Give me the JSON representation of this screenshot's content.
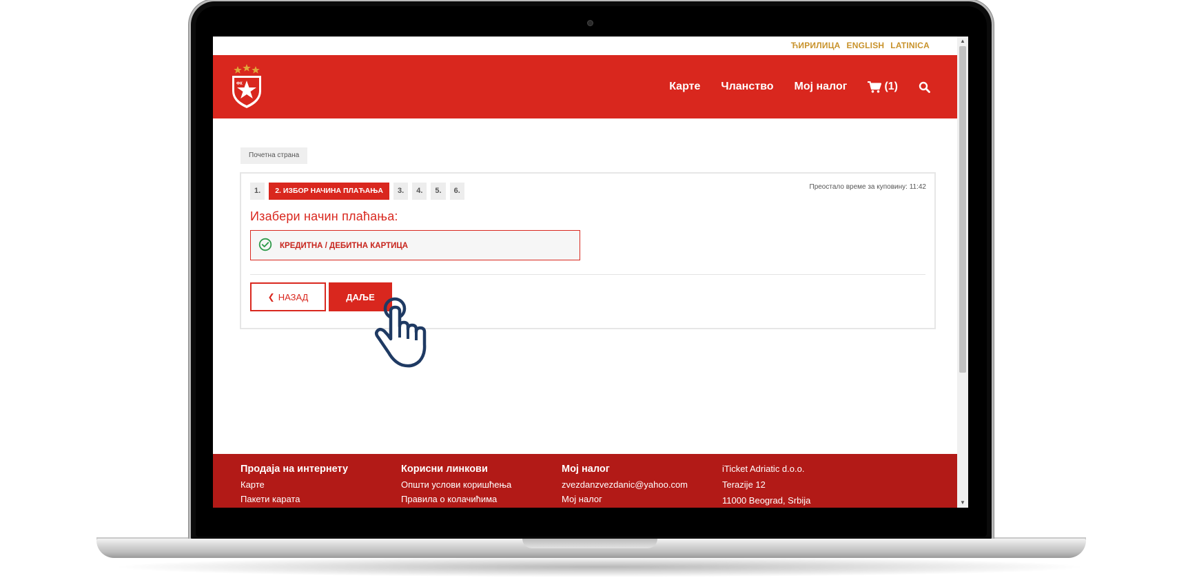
{
  "language_links": [
    "ЋИРИЛИЦА",
    "ENGLISH",
    "LATINICA"
  ],
  "nav": {
    "items": [
      "Карте",
      "Чланство",
      "Мој налог"
    ],
    "cart_label": "(1)"
  },
  "breadcrumb": "Почетна страна",
  "checkout": {
    "steps": [
      "1.",
      "2. ИЗБОР НАЧИНА ПЛАЋАЊА",
      "3.",
      "4.",
      "5.",
      "6."
    ],
    "active_step": 2,
    "timer_text": "Преостало време за куповину: 11:42",
    "heading": "Изабери начин плаћања:",
    "payment_option": "КРЕДИТНА / ДЕБИТНА КАРТИЦА",
    "back_label": "НАЗАД",
    "next_label": "ДАЉЕ"
  },
  "footer": {
    "columns": [
      {
        "title": "Продаја на интернету",
        "items": [
          "Карте",
          "Пакети карата"
        ]
      },
      {
        "title": "Корисни линкови",
        "items": [
          "Општи услови коришћења",
          "Правила о колачићима"
        ]
      },
      {
        "title": "Мој налог",
        "items": [
          "zvezdanzvezdanic@yahoo.com",
          "Мој налог"
        ]
      }
    ],
    "address": [
      "iTicket Adriatic d.o.o.",
      "Terazije 12",
      "11000 Beograd, Srbija"
    ]
  },
  "colors": {
    "brand_red": "#d9271e",
    "footer_red": "#b21a17",
    "gold": "#c8922a",
    "success_green": "#2e9a4a",
    "hand_cursor": "#1f3a63"
  },
  "icons": {
    "logo": "red-star-crest-icon",
    "cart": "cart-icon",
    "search": "search-icon",
    "check": "check-circle-icon",
    "cursor": "hand-pointer-icon"
  }
}
